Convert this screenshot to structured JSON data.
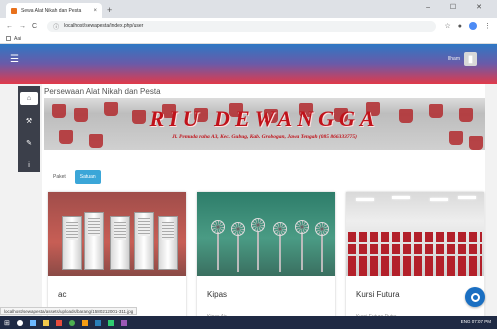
{
  "browser": {
    "tab_title": "Sewa Alat Nikah dan Pesta",
    "tab_close": "×",
    "new_tab": "+",
    "window_controls": "– ☐ ✕",
    "back": "←",
    "forward": "→",
    "reload": "C",
    "url": "localhost/sewapesta/index.php/user",
    "bookmark_label": "Aai",
    "star_icon": "☆",
    "menu_icon": "⋮"
  },
  "header": {
    "menu_icon": "☰",
    "admin_label": "Ilham",
    "avatar_glyph": "▮"
  },
  "sidebar": {
    "items": [
      {
        "icon": "⌂",
        "name": "home",
        "active": true
      },
      {
        "icon": "⚒",
        "name": "cart",
        "active": false
      },
      {
        "icon": "✎",
        "name": "edit",
        "active": false
      },
      {
        "icon": "i",
        "name": "info",
        "active": false
      }
    ]
  },
  "main": {
    "page_title": "Persewaan Alat Nikah dan Pesta",
    "banner_title": "RIU DEWANGGA",
    "banner_address": "Jl. Pemuda raha A3, Kec. Gubug, Kab. Grobogan, Jawa Tengah (085 866333775)",
    "tabs": [
      {
        "label": "Paket",
        "active": false
      },
      {
        "label": "Satuan",
        "active": true
      }
    ],
    "cards": [
      {
        "name": "ac",
        "sub": "",
        "image": "ac"
      },
      {
        "name": "Kipas",
        "sub": "Kipas Air",
        "image": "kipas"
      },
      {
        "name": "Kursi Futura",
        "sub": "Kursi Futura Putra",
        "image": "kursi"
      }
    ]
  },
  "statusbar": {
    "text": "localhost/sewapesta/assets/uploads/barang/1580212001-311.jpg"
  },
  "taskbar": {
    "clock": "ENG  07:07 PM"
  },
  "colors": {
    "header_top": "#2f78c4",
    "header_bottom": "#e13a4a",
    "tab_active": "#3ba6d8",
    "banner_text": "#c0121a",
    "fab": "#1a6fc2"
  }
}
